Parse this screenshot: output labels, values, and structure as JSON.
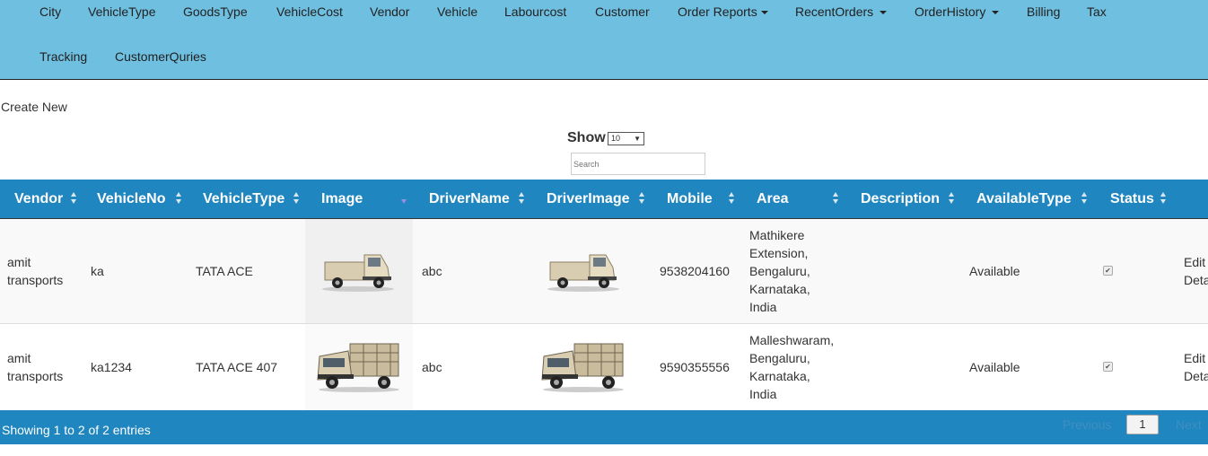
{
  "nav": {
    "items": [
      {
        "label": "City",
        "dropdown": false
      },
      {
        "label": "VehicleType",
        "dropdown": false
      },
      {
        "label": "GoodsType",
        "dropdown": false
      },
      {
        "label": "VehicleCost",
        "dropdown": false
      },
      {
        "label": "Vendor",
        "dropdown": false
      },
      {
        "label": "Vehicle",
        "dropdown": false
      },
      {
        "label": "Labourcost",
        "dropdown": false
      },
      {
        "label": "Customer",
        "dropdown": false
      },
      {
        "label": "Order Reports",
        "dropdown": true
      },
      {
        "label": "RecentOrders",
        "dropdown": true
      },
      {
        "label": "OrderHistory",
        "dropdown": true
      },
      {
        "label": "Billing",
        "dropdown": false
      },
      {
        "label": "Tax",
        "dropdown": false
      },
      {
        "label": "Tracking",
        "dropdown": false
      },
      {
        "label": "CustomerQuries",
        "dropdown": false
      }
    ]
  },
  "create_new": "Create New",
  "length": {
    "label": "Show",
    "selected": "10"
  },
  "search": {
    "placeholder": "Search"
  },
  "table": {
    "columns": [
      "Vendor",
      "VehicleNo",
      "VehicleType",
      "Image",
      "DriverName",
      "DriverImage",
      "Mobile",
      "Area",
      "Description",
      "AvailableType",
      "Status"
    ],
    "rows": [
      {
        "vendor": "amit transports",
        "vehicle_no": "ka",
        "vehicle_type": "TATA ACE",
        "driver_name": "abc",
        "mobile": "9538204160",
        "area": "Mathikere Extension, Bengaluru, Karnataka, India",
        "description": "",
        "available_type": "Available",
        "status_checked": true,
        "actions": [
          "Edit",
          "Deta"
        ]
      },
      {
        "vendor": "amit transports",
        "vehicle_no": "ka1234",
        "vehicle_type": "TATA ACE 407",
        "driver_name": "abc",
        "mobile": "9590355556",
        "area": "Malleshwaram, Bengaluru, Karnataka, India",
        "description": "",
        "available_type": "Available",
        "status_checked": true,
        "actions": [
          "Edit",
          "Deta"
        ]
      }
    ]
  },
  "footer": {
    "info": "Showing 1 to 2 of 2 entries",
    "previous": "Previous",
    "page": "1",
    "next": "Next"
  },
  "colors": {
    "navbar": "#6fbfe0",
    "header": "#1f86c0"
  },
  "icons": [
    "sort-icon",
    "checkbox-icon",
    "truck-image",
    "caret-down-icon"
  ]
}
